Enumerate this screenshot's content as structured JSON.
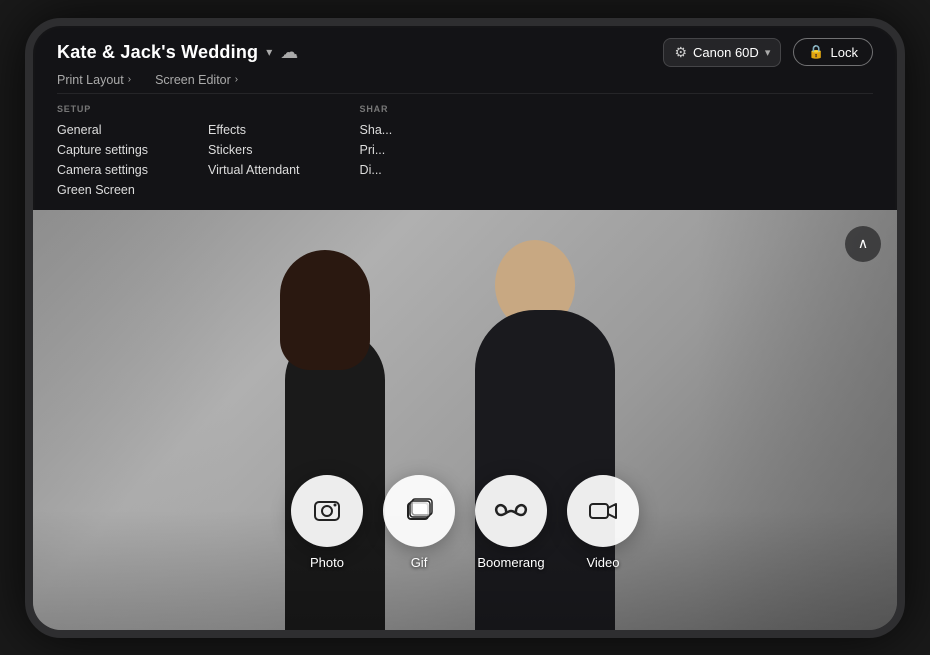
{
  "header": {
    "event_title": "Kate & Jack's Wedding",
    "cloud_icon": "☁",
    "chevron_icon": "▾",
    "camera": {
      "icon": "⚙",
      "name": "Canon 60D",
      "chevron": "▾"
    },
    "lock_label": "Lock",
    "lock_icon": "🔒"
  },
  "nav": {
    "print_layout": "Print Layout",
    "screen_editor": "Screen Editor",
    "nav_chevron": "›"
  },
  "menu": {
    "setup_label": "SETUP",
    "setup_items": [
      "General",
      "Capture settings",
      "Camera settings",
      "Green Screen"
    ],
    "effects_label": "",
    "effects_items": [
      "Effects",
      "Stickers",
      "Virtual Attendant"
    ],
    "share_label": "SHAR",
    "share_items": [
      "Sha...",
      "Pri...",
      "Di..."
    ]
  },
  "capture_modes": [
    {
      "id": "photo",
      "label": "Photo",
      "icon": "📷"
    },
    {
      "id": "gif",
      "label": "Gif",
      "icon": "🎞"
    },
    {
      "id": "boomerang",
      "label": "Boomerang",
      "icon": "∞"
    },
    {
      "id": "video",
      "label": "Video",
      "icon": "🎬"
    }
  ],
  "scroll_up_icon": "∧",
  "colors": {
    "header_bg": "#141416",
    "accent": "#ffffff"
  }
}
